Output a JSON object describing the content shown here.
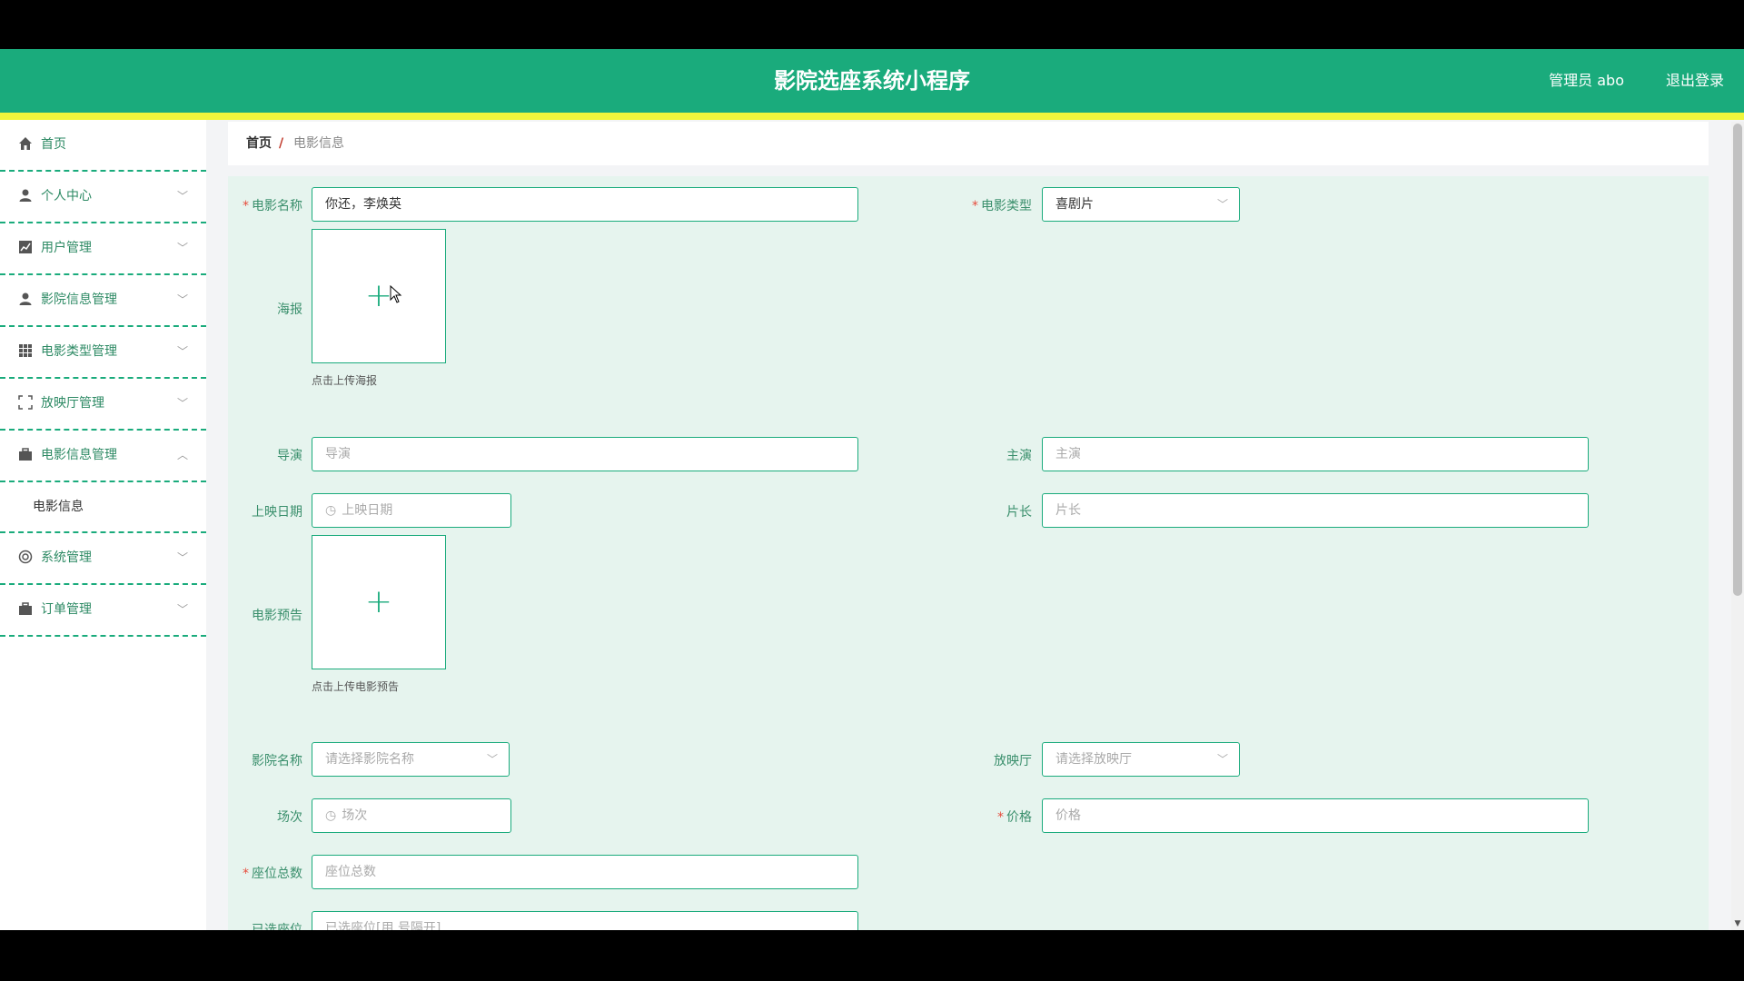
{
  "header": {
    "title": "影院选座系统小程序",
    "admin": "管理员 abo",
    "logout": "退出登录"
  },
  "sidebar": {
    "items": [
      {
        "label": "首页",
        "icon": "home-icon"
      },
      {
        "label": "个人中心",
        "icon": "user-icon"
      },
      {
        "label": "用户管理",
        "icon": "chart-icon"
      },
      {
        "label": "影院信息管理",
        "icon": "user-icon"
      },
      {
        "label": "电影类型管理",
        "icon": "grid-icon"
      },
      {
        "label": "放映厅管理",
        "icon": "fullscreen-icon"
      },
      {
        "label": "电影信息管理",
        "icon": "briefcase-icon"
      },
      {
        "label": "系统管理",
        "icon": "settings-icon"
      },
      {
        "label": "订单管理",
        "icon": "briefcase-icon"
      }
    ],
    "sub_item": "电影信息"
  },
  "breadcrumb": {
    "home": "首页",
    "separator": "/",
    "current": "电影信息"
  },
  "form": {
    "movie_name": {
      "label": "电影名称",
      "value": "你还，李焕英"
    },
    "movie_type": {
      "label": "电影类型",
      "value": "喜剧片"
    },
    "poster": {
      "label": "海报",
      "hint": "点击上传海报"
    },
    "director": {
      "label": "导演",
      "placeholder": "导演"
    },
    "actor": {
      "label": "主演",
      "placeholder": "主演"
    },
    "release_date": {
      "label": "上映日期",
      "placeholder": "上映日期"
    },
    "duration": {
      "label": "片长",
      "placeholder": "片长"
    },
    "trailer": {
      "label": "电影预告",
      "hint": "点击上传电影预告"
    },
    "cinema_name": {
      "label": "影院名称",
      "placeholder": "请选择影院名称"
    },
    "hall": {
      "label": "放映厅",
      "placeholder": "请选择放映厅"
    },
    "session": {
      "label": "场次",
      "placeholder": "场次"
    },
    "price": {
      "label": "价格",
      "placeholder": "价格"
    },
    "total_seats": {
      "label": "座位总数",
      "placeholder": "座位总数"
    },
    "selected_seats": {
      "label": "已选座位",
      "placeholder": "已选座位[用,号隔开]"
    },
    "required_mark": "*",
    "plus": "+"
  },
  "colors": {
    "primary": "#1aab7c",
    "highlight_bar": "#f0f53c",
    "required": "#e74c3c",
    "form_bg": "#e6f4ee"
  }
}
